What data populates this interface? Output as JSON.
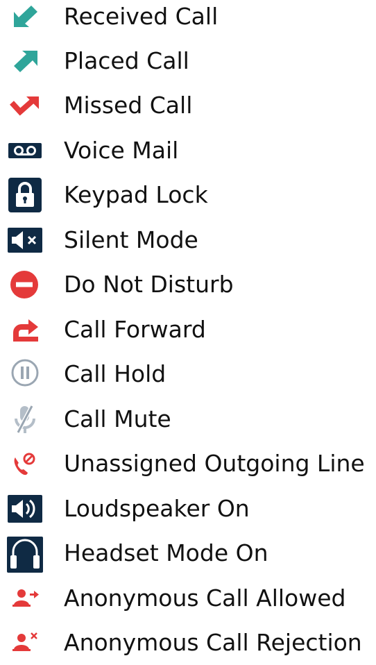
{
  "legend": {
    "items": [
      {
        "label": "Received Call",
        "icon": "received-call-icon",
        "color": "#2fa59a"
      },
      {
        "label": "Placed Call",
        "icon": "placed-call-icon",
        "color": "#2fa59a"
      },
      {
        "label": "Missed Call",
        "icon": "missed-call-icon",
        "color": "#e43a3a"
      },
      {
        "label": "Voice Mail",
        "icon": "voicemail-icon",
        "color": "#0f2a44"
      },
      {
        "label": "Keypad Lock",
        "icon": "lock-icon",
        "color": "#0f2a44"
      },
      {
        "label": "Silent Mode",
        "icon": "speaker-muted-icon",
        "color": "#0f2a44"
      },
      {
        "label": "Do Not Disturb",
        "icon": "do-not-disturb-icon",
        "color": "#e43a3a"
      },
      {
        "label": "Call Forward",
        "icon": "call-forward-icon",
        "color": "#e43a3a"
      },
      {
        "label": "Call Hold",
        "icon": "pause-icon",
        "color": "#9aa6b2"
      },
      {
        "label": "Call Mute",
        "icon": "microphone-muted-icon",
        "color": "#9aa6b2"
      },
      {
        "label": "Unassigned Outgoing Line",
        "icon": "phone-blocked-icon",
        "color": "#e43a3a"
      },
      {
        "label": "Loudspeaker On",
        "icon": "speaker-on-icon",
        "color": "#0f2a44"
      },
      {
        "label": "Headset Mode On",
        "icon": "headset-icon",
        "color": "#0f2a44"
      },
      {
        "label": "Anonymous Call Allowed",
        "icon": "anonymous-call-allowed-icon",
        "color": "#e43a3a"
      },
      {
        "label": "Anonymous Call Rejection",
        "icon": "anonymous-call-rejection-icon",
        "color": "#e43a3a"
      }
    ]
  }
}
